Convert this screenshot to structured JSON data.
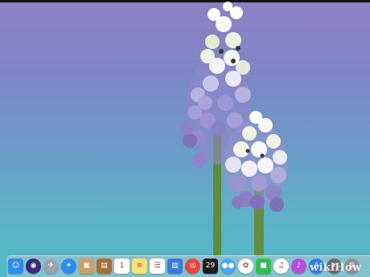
{
  "screen": {
    "kind": "macOS desktop",
    "wallpaper": "grape hyacinth flowers on purple-teal gradient"
  },
  "dock": {
    "items": [
      {
        "name": "finder",
        "icon": "finder-icon",
        "color": "#2e8ff0",
        "glyph": "☺"
      },
      {
        "name": "siri",
        "icon": "siri-icon",
        "color": "#3b2c7a",
        "glyph": "◉"
      },
      {
        "name": "launchpad",
        "icon": "rocket-icon",
        "color": "#9aa3ad",
        "glyph": "✈"
      },
      {
        "name": "safari",
        "icon": "compass-icon",
        "color": "#2d8cf0",
        "glyph": "✦"
      },
      {
        "name": "preview",
        "icon": "photo-icon",
        "color": "#c9a066",
        "glyph": "▣"
      },
      {
        "name": "notes-book",
        "icon": "book-icon",
        "color": "#a5703a",
        "glyph": "▤"
      },
      {
        "name": "calendar",
        "icon": "calendar-icon",
        "color": "#ffffff",
        "glyph": "1"
      },
      {
        "name": "notes",
        "icon": "note-icon",
        "color": "#f6e27a",
        "glyph": "≡"
      },
      {
        "name": "reminders",
        "icon": "list-icon",
        "color": "#ffffff",
        "glyph": "☰"
      },
      {
        "name": "keynote",
        "icon": "presentation-icon",
        "color": "#3a7bd5",
        "glyph": "▥"
      },
      {
        "name": "chrome",
        "icon": "chrome-icon",
        "color": "#e8453c",
        "glyph": "◎"
      },
      {
        "name": "calendar-app",
        "icon": "calendar-dark-icon",
        "color": "#1d1d1f",
        "glyph": "29"
      },
      {
        "name": "messages",
        "icon": "chat-bubble-icon",
        "color": "#4aa3f0",
        "glyph": "●●"
      },
      {
        "name": "photos",
        "icon": "photos-icon",
        "color": "#ffffff",
        "glyph": "✿"
      },
      {
        "name": "facetime",
        "icon": "camera-icon",
        "color": "#2fbf4a",
        "glyph": "■"
      },
      {
        "name": "music",
        "icon": "music-note-icon",
        "color": "#ffffff",
        "glyph": "♫"
      },
      {
        "name": "itunes",
        "icon": "disc-icon",
        "color": "#b64fe0",
        "glyph": "♪"
      },
      {
        "name": "app-store",
        "icon": "app-store-icon",
        "color": "#2d7cf0",
        "glyph": "A"
      },
      {
        "name": "screenshot",
        "icon": "screenshot-icon",
        "color": "#6b6b6b",
        "glyph": "⌖"
      },
      {
        "name": "system-preferences",
        "icon": "gear-icon",
        "color": "#8e8e93",
        "glyph": "⚙"
      }
    ]
  },
  "watermark": {
    "text": "wikiHow"
  }
}
